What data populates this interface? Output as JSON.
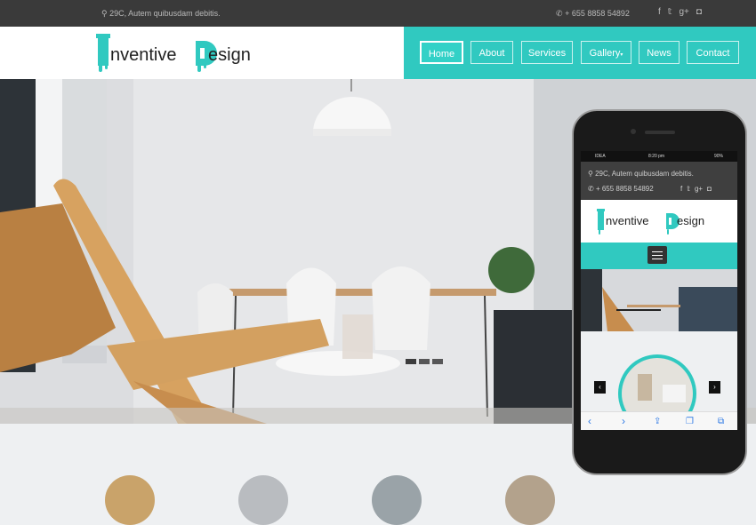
{
  "topbar": {
    "address": "29C, Autem quibusdam debitis.",
    "phone": "+ 655 8858 54892",
    "social": [
      "f",
      "𝕥",
      "g+",
      "◘"
    ]
  },
  "logo": {
    "word1": "nventive",
    "word2": "esign"
  },
  "nav": {
    "items": [
      "Home",
      "About",
      "Services",
      "Gallery",
      "News",
      "Contact"
    ]
  },
  "mobile": {
    "carrier": "IDEA",
    "time": "8:20 pm",
    "battery": "90%",
    "address": "29C, Autem quibusdam debitis.",
    "phone": "+ 655 8858 54892",
    "logo_word1": "nventive",
    "logo_word2": "esign"
  },
  "colors": {
    "accent": "#30c9c0",
    "topbar": "#3a3a3a"
  }
}
